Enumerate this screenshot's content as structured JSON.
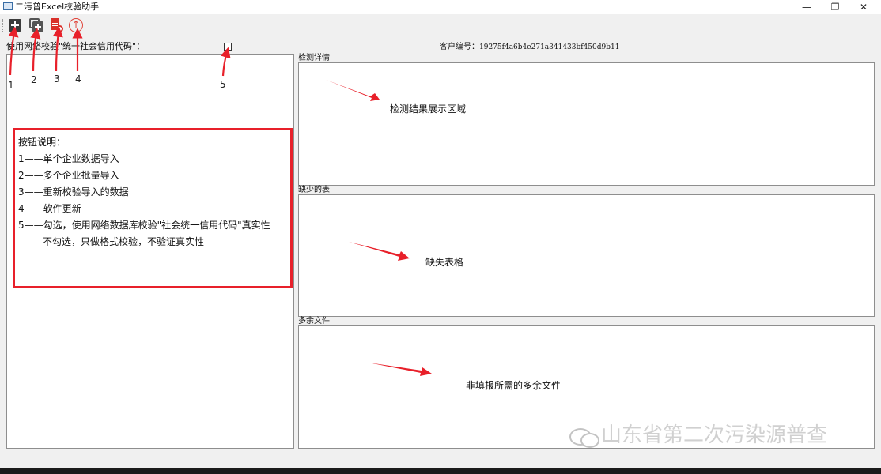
{
  "window": {
    "title": "二污普Excel校验助手",
    "minimize_glyph": "—",
    "maximize_glyph": "❐",
    "close_glyph": "✕"
  },
  "toolbar": {
    "buttons": [
      {
        "icon": "single-import-icon"
      },
      {
        "icon": "batch-import-icon"
      },
      {
        "icon": "revalidate-icon"
      },
      {
        "icon": "update-icon"
      }
    ]
  },
  "options": {
    "network_check_label": "使用网络校验\"统一社会信用代码\"：",
    "network_check_checked": false
  },
  "client": {
    "label": "客户编号：",
    "id": "19275f4a6b4e271a341433bf450d9b11"
  },
  "instructions": {
    "title": "按钮说明：",
    "lines": [
      "1——单个企业数据导入",
      "2——多个企业批量导入",
      "3——重新校验导入的数据",
      "4——软件更新",
      "5——勾选，使用网络数据库校验\"社会统一信用代码\"真实性",
      "不勾选，只做格式校验，不验证真实性"
    ]
  },
  "annotation_numbers": [
    "1",
    "2",
    "3",
    "4",
    "5"
  ],
  "panels": {
    "detection": {
      "label": "检测详情",
      "content": "检测结果展示区域"
    },
    "missing": {
      "label": "缺少的表",
      "content": "缺失表格"
    },
    "extra": {
      "label": "多余文件",
      "content": "非填报所需的多余文件"
    }
  },
  "watermark": "山东省第二次污染源普查",
  "colors": {
    "annotation_red": "#e8202a",
    "toolbar_icon_dark": "#3b3b3b",
    "revalidate_red": "#d9312b"
  }
}
